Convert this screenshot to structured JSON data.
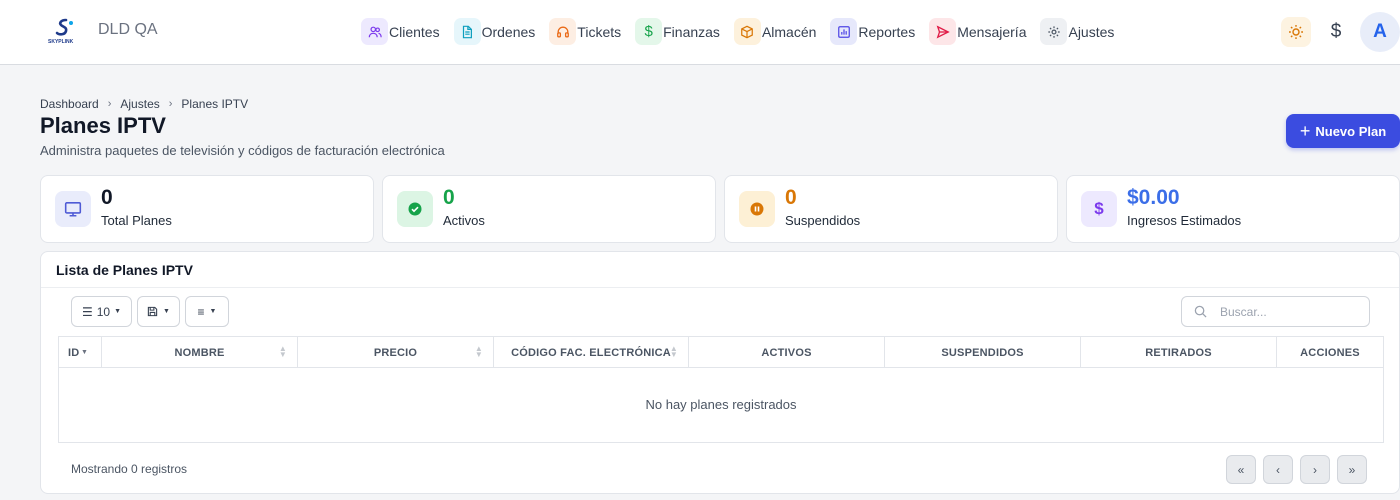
{
  "app": {
    "brand": "DLD QA",
    "logo_text": "SKYPLINK"
  },
  "nav": [
    {
      "label": "Clientes",
      "icon": "users-icon",
      "bg": "#ede9fe",
      "color": "#7c3aed"
    },
    {
      "label": "Ordenes",
      "icon": "document-icon",
      "bg": "#e6f6fb",
      "color": "#0e9fbe"
    },
    {
      "label": "Tickets",
      "icon": "headset-icon",
      "bg": "#fdeee3",
      "color": "#ea6a17"
    },
    {
      "label": "Finanzas",
      "icon": "dollar-icon",
      "bg": "#e4f7ea",
      "color": "#16a34a"
    },
    {
      "label": "Almacén",
      "icon": "box-icon",
      "bg": "#fdf1dc",
      "color": "#d97706"
    },
    {
      "label": "Reportes",
      "icon": "chart-icon",
      "bg": "#e6e8fb",
      "color": "#4f46e5"
    },
    {
      "label": "Mensajería",
      "icon": "send-icon",
      "bg": "#fde6e8",
      "color": "#e11d48"
    },
    {
      "label": "Ajustes",
      "icon": "gear-icon",
      "bg": "#eef0f3",
      "color": "#4b5563"
    }
  ],
  "topright": {
    "currency_symbol": "$",
    "avatar_initial": "A"
  },
  "breadcrumb": [
    "Dashboard",
    "Ajustes",
    "Planes IPTV"
  ],
  "page": {
    "title": "Planes IPTV",
    "subtitle": "Administra paquetes de televisión y códigos de facturación electrónica",
    "new_button": "Nuevo Plan"
  },
  "stats": [
    {
      "value": "0",
      "label": "Total Planes",
      "icon": "monitor-icon",
      "value_color": "#111827",
      "icon_bg": "#e9ecfb",
      "icon_color": "#4f5bd5"
    },
    {
      "value": "0",
      "label": "Activos",
      "icon": "check-circle-icon",
      "value_color": "#16a34a",
      "icon_bg": "#dcf5e4",
      "icon_color": "#16a34a"
    },
    {
      "value": "0",
      "label": "Suspendidos",
      "icon": "pause-circle-icon",
      "value_color": "#d97706",
      "icon_bg": "#fdf0d5",
      "icon_color": "#d97706"
    },
    {
      "value": "$0.00",
      "label": "Ingresos Estimados",
      "icon": "dollar-icon",
      "value_color": "#3b6ee8",
      "icon_bg": "#ede9fe",
      "icon_color": "#7c3aed"
    }
  ],
  "table": {
    "title": "Lista de Planes IPTV",
    "page_size": "10",
    "search_placeholder": "Buscar...",
    "columns": [
      "ID",
      "NOMBRE",
      "PRECIO",
      "CÓDIGO FAC. ELECTRÓNICA",
      "ACTIVOS",
      "SUSPENDIDOS",
      "RETIRADOS",
      "ACCIONES"
    ],
    "empty_message": "No hay planes registrados",
    "footer": "Mostrando 0 registros",
    "pagination": [
      "«",
      "‹",
      "›",
      "»"
    ]
  }
}
